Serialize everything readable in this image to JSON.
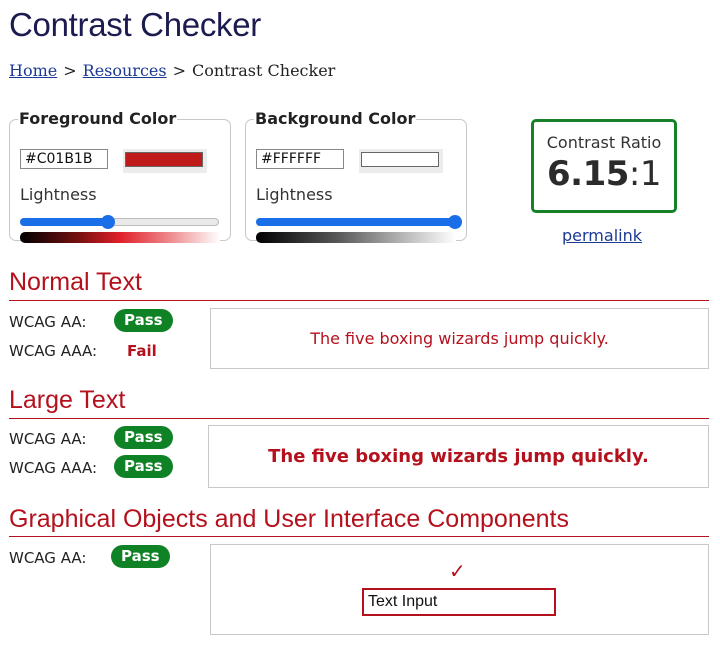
{
  "page": {
    "title": "Contrast Checker"
  },
  "breadcrumb": {
    "items": [
      {
        "label": "Home",
        "link": true
      },
      {
        "label": "Resources",
        "link": true
      },
      {
        "label": "Contrast Checker",
        "link": false
      }
    ],
    "separator": ">"
  },
  "foreground": {
    "legend": "Foreground Color",
    "hex_value": "#C01B1B",
    "swatch_color": "#C01B1B",
    "lightness_label": "Lightness",
    "lightness_percent": 44
  },
  "background": {
    "legend": "Background Color",
    "hex_value": "#FFFFFF",
    "swatch_color": "#FFFFFF",
    "lightness_label": "Lightness",
    "lightness_percent": 100
  },
  "contrast": {
    "label": "Contrast Ratio",
    "ratio_value": "6.15",
    "ratio_colon": ":",
    "ratio_suffix": "1",
    "permalink_label": "permalink"
  },
  "normal_text": {
    "heading": "Normal Text",
    "aa_label": "WCAG AA:",
    "aa_result": "Pass",
    "aaa_label": "WCAG AAA:",
    "aaa_result": "Fail",
    "sample": "The five boxing wizards jump quickly."
  },
  "large_text": {
    "heading": "Large Text",
    "aa_label": "WCAG AA:",
    "aa_result": "Pass",
    "aaa_label": "WCAG AAA:",
    "aaa_result": "Pass",
    "sample": "The five boxing wizards jump quickly."
  },
  "graphical": {
    "heading": "Graphical Objects and User Interface Components",
    "aa_label": "WCAG AA:",
    "aa_result": "Pass",
    "check_glyph": "✓",
    "input_value": "Text Input"
  },
  "colors": {
    "accent_red": "#B4111D",
    "pass_green": "#108226",
    "link_blue": "#1C3A94",
    "slider_blue": "#1A6FE8"
  }
}
